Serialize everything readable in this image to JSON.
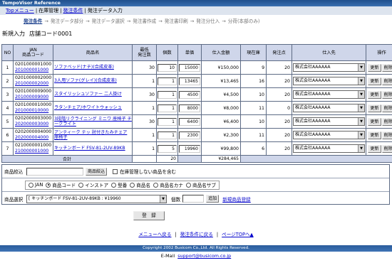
{
  "app_title": "TempoVisor Reference",
  "breadcrumb": [
    "Topメニュー",
    "在庫管理",
    "発注条件",
    "発注データ入力"
  ],
  "steps": [
    "発注条件",
    "発注データ部分",
    "発注データ選択",
    "発注書作成",
    "発注書印刷",
    "発注分仕入",
    "分荷(本部のみ)"
  ],
  "page_title": "新規入力",
  "store_code": "店舗コード0001",
  "columns": [
    "NO",
    "JAN\n商品コード",
    "商品名",
    "最低\n発注数",
    "個数",
    "単価",
    "仕入金額",
    "現在庫",
    "発注点",
    "仕入先",
    "操作"
  ],
  "rows": [
    {
      "no": "1",
      "jan": "0201000001000",
      "code": "201000001000",
      "name": "ソファベッド(ナチ)(合成皮革)",
      "min": "30",
      "qty": "10",
      "price": "15000",
      "amount": "¥150,000",
      "stock": "9",
      "order_point": "20",
      "supplier": "株式会社AAAAAA"
    },
    {
      "no": "2",
      "jan": "0201000002000",
      "code": "201000002000",
      "name": "3人用ソファ(グレイ)(合成皮革)",
      "min": "1",
      "qty": "1",
      "price": "13465",
      "amount": "¥13,465",
      "stock": "16",
      "order_point": "20",
      "supplier": "株式会社AAAAAA"
    },
    {
      "no": "3",
      "jan": "0201000009000",
      "code": "201000009000",
      "name": "スタイリッシュソファー 二人掛け",
      "min": "30",
      "qty": "1",
      "price": "4500",
      "amount": "¥4,500",
      "stock": "10",
      "order_point": "20",
      "supplier": "株式会社AAAAAA"
    },
    {
      "no": "4",
      "jan": "0201000010000",
      "code": "201000010000",
      "name": "ラタンチェア/ホワイトウォッシュ",
      "min": "1",
      "qty": "1",
      "price": "8000",
      "amount": "¥8,000",
      "stock": "11",
      "order_point": "0",
      "supplier": "株式会社AAAAAA"
    },
    {
      "no": "5",
      "jan": "0202000003000",
      "code": "202000003000",
      "name": "3段階リクライニング ミニワ 座椅子 チークライト",
      "min": "30",
      "qty": "1",
      "price": "6400",
      "amount": "¥6,400",
      "stock": "10",
      "order_point": "20",
      "supplier": "株式会社AAAAAA"
    },
    {
      "no": "6",
      "jan": "0202000004000",
      "code": "202000004000",
      "name": "アンティーク テッ 肘付きたみチェア 座椅子",
      "min": "1",
      "qty": "1",
      "price": "2300",
      "amount": "¥2,300",
      "stock": "11",
      "order_point": "20",
      "supplier": "株式会社AAAAAA"
    },
    {
      "no": "7",
      "jan": "0210000001000",
      "code": "210000001000",
      "name": "キッチンボード FSV-81-2UV-89KB",
      "min": "1",
      "qty": "5",
      "price": "19960",
      "amount": "¥99,800",
      "stock": "6",
      "order_point": "20",
      "supplier": "株式会社AAAAAA"
    }
  ],
  "ops": {
    "update": "更新",
    "delete": "削除"
  },
  "total": {
    "label": "合計",
    "qty": "20",
    "amount": "¥284,465"
  },
  "search": {
    "label": "商品絞込",
    "button": "商品絞込",
    "exclude_label": "在庫管理しない商品を含む",
    "radios": [
      "JAN",
      "商品コード",
      "インストア",
      "型番",
      "商品名",
      "商品名カナ",
      "商品名サブ"
    ],
    "selected_radio": "商品コード",
    "select_label": "商品選択",
    "select_value": "[ キッチンボード FSV-81-2UV-89KB : ¥19960",
    "qty_label": "個数",
    "add_button": "追加",
    "new_link": "新規商品登録"
  },
  "register_button": "登　録",
  "footer_links": [
    "メニューへ戻る",
    "発注条件に戻る",
    "ページTOPへ▲"
  ],
  "copyright": "Copyright 2002 Busicom Co.,Ltd. All Rights Reserved.",
  "email_label": "E-Mail",
  "email": "support@busicom.co.jp",
  "colors": {
    "header_bg": "#1f4f8c",
    "table_header_bg": "#cfd6ea",
    "link": "#0000cc",
    "breadcrumb_bg": "#dde4ee"
  }
}
